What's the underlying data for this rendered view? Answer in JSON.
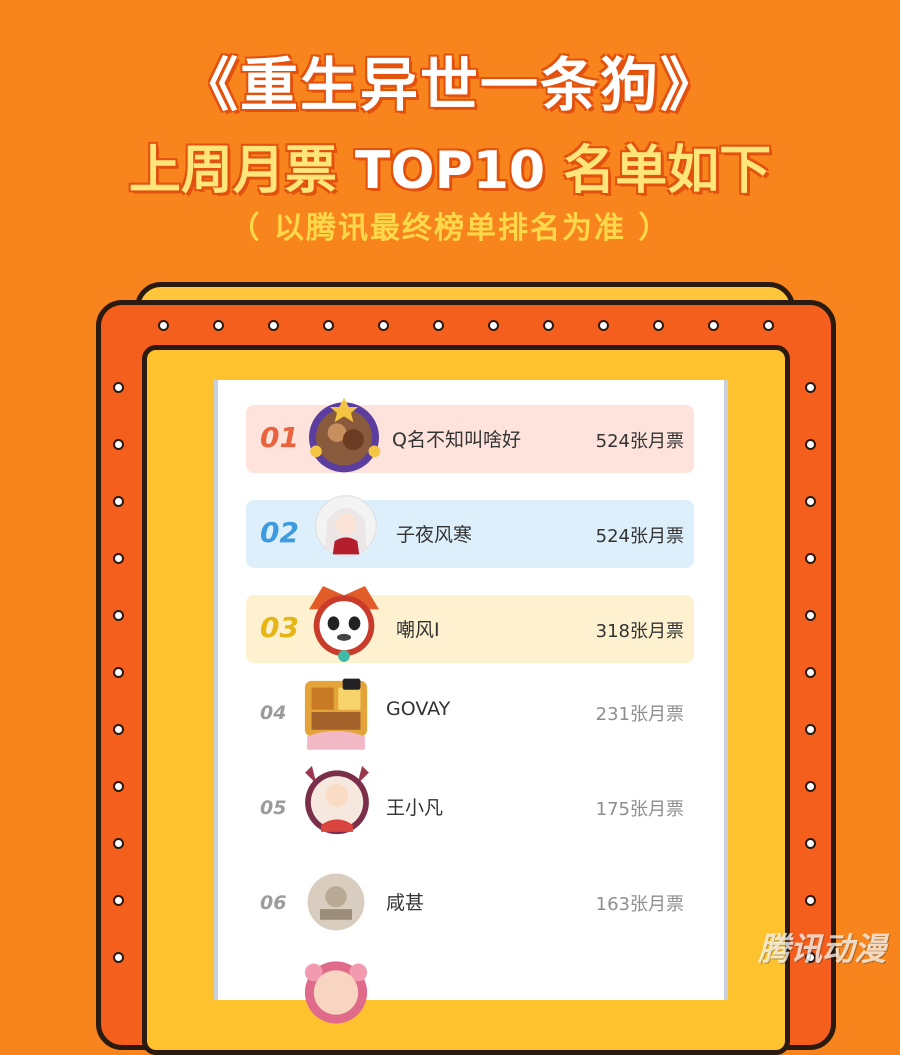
{
  "header": {
    "title": "《重生异世一条狗》",
    "subtitle_part1": "上周月票 ",
    "subtitle_part2": "TOP10",
    "subtitle_part3": " 名单如下",
    "note": "（ 以腾讯最终榜单排名为准 ）"
  },
  "ranking": [
    {
      "rank": "01",
      "name": "Q名不知叫啥好",
      "votes": "524张月票"
    },
    {
      "rank": "02",
      "name": "子夜风寒",
      "votes": "524张月票"
    },
    {
      "rank": "03",
      "name": "嘲风I",
      "votes": "318张月票"
    },
    {
      "rank": "04",
      "name": "GOVAY",
      "votes": "231张月票"
    },
    {
      "rank": "05",
      "name": "王小凡",
      "votes": "175张月票"
    },
    {
      "rank": "06",
      "name": "咸甚",
      "votes": "163张月票"
    }
  ],
  "watermark": "腾讯动漫",
  "colors": {
    "background": "#F7841D",
    "rank1": "#E9633E",
    "rank2": "#3E9BE0",
    "rank3": "#E6B516"
  }
}
